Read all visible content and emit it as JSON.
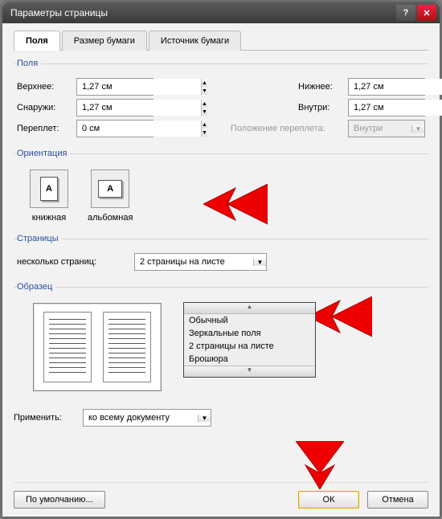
{
  "window": {
    "title": "Параметры страницы"
  },
  "tabs": {
    "t0": "Поля",
    "t1": "Размер бумаги",
    "t2": "Источник бумаги"
  },
  "margins": {
    "legend": "Поля",
    "top_lbl": "Верхнее:",
    "top_val": "1,27 см",
    "bottom_lbl": "Нижнее:",
    "bottom_val": "1,27 см",
    "outside_lbl": "Снаружи:",
    "outside_val": "1,27 см",
    "inside_lbl": "Внутри:",
    "inside_val": "1,27 см",
    "gutter_lbl": "Переплет:",
    "gutter_val": "0 см",
    "gutterpos_lbl": "Положение переплета:",
    "gutterpos_val": "Внутри"
  },
  "orientation": {
    "legend": "Ориентация",
    "portrait": "книжная",
    "landscape": "альбомная",
    "glyph": "A"
  },
  "pages": {
    "legend": "Страницы",
    "multi_lbl": "несколько страниц:",
    "multi_val": "2 страницы на листе",
    "options": {
      "o0": "Обычный",
      "o1": "Зеркальные поля",
      "o2": "2 страницы на листе",
      "o3": "Брошюра"
    }
  },
  "preview": {
    "legend": "Образец"
  },
  "apply": {
    "lbl": "Применить:",
    "val": "ко всему документу"
  },
  "buttons": {
    "default": "По умолчанию...",
    "ok": "ОК",
    "cancel": "Отмена"
  }
}
